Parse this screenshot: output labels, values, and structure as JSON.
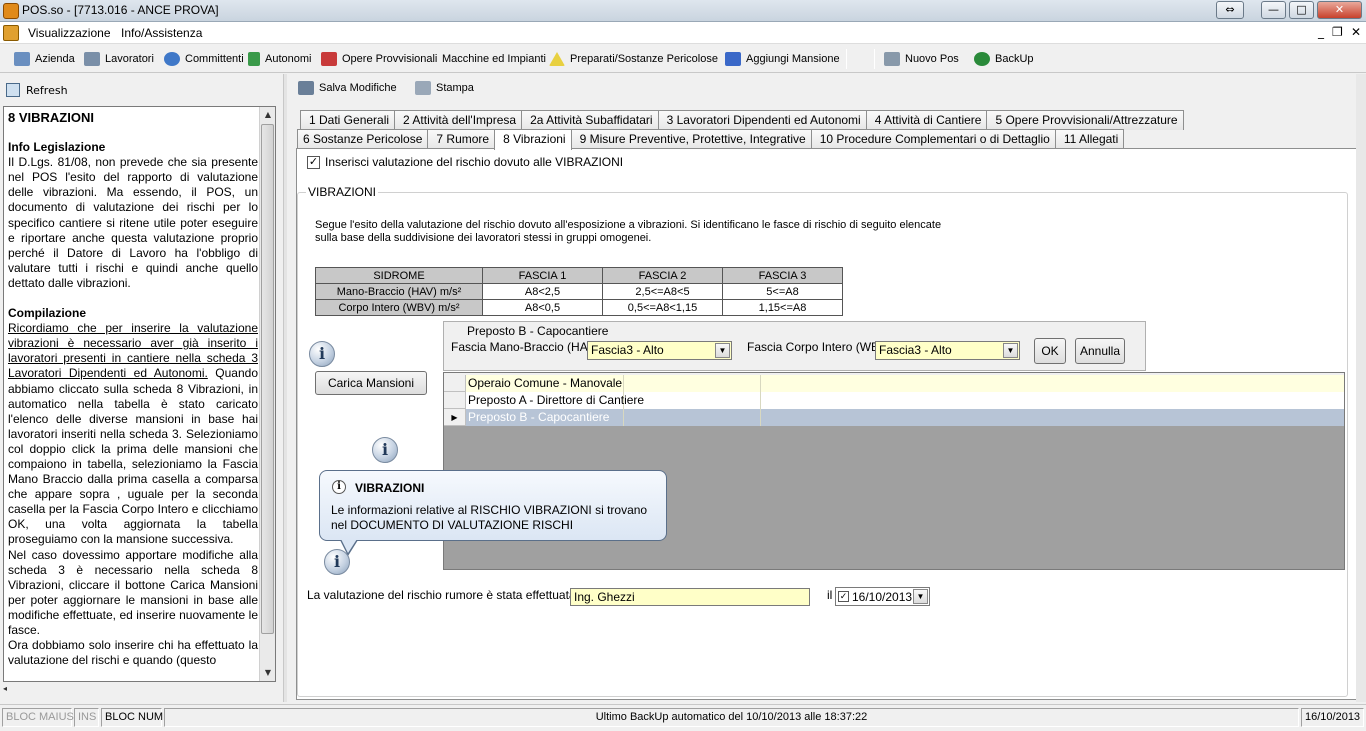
{
  "window": {
    "title": "POS.so - [7713.016 - ANCE PROVA]",
    "min": "—",
    "max": "□",
    "close": "✕",
    "restore": "⇔"
  },
  "menu": {
    "items": [
      "Visualizzazione",
      "Info/Assistenza"
    ],
    "mdi_min": "_",
    "mdi_restore": "❐",
    "mdi_close": "✕"
  },
  "toolbar": {
    "items": [
      {
        "label": "Azienda",
        "icon": "building-icon"
      },
      {
        "label": "Lavoratori",
        "icon": "worker-icon"
      },
      {
        "label": "Committenti",
        "icon": "people-icon"
      },
      {
        "label": "Autonomi",
        "icon": "person-icon"
      },
      {
        "label": "Opere Provvisionali",
        "icon": "truck-icon"
      },
      {
        "label": "Macchine ed Impianti",
        "icon": ""
      },
      {
        "label": "Preparati/Sostanze Pericolose",
        "icon": "hazard-icon"
      },
      {
        "label": "Aggiungi Mansione",
        "icon": "puzzle-icon"
      },
      {
        "label": "Nuovo Pos",
        "icon": "new-doc-icon"
      },
      {
        "label": "BackUp",
        "icon": "backup-icon"
      }
    ]
  },
  "left": {
    "refresh": "Refresh",
    "help": {
      "title": "8 VIBRAZIONI",
      "s1_title": "Info Legislazione",
      "s1_text": "Il D.Lgs. 81/08, non prevede che sia presente nel POS l'esito del rapporto di valutazione delle vibrazioni. Ma essendo, il POS, un documento di valutazione dei rischi per lo specifico cantiere si ritene utile poter eseguire e riportare anche questa valutazione proprio perché il Datore di Lavoro ha l'obbligo di valutare tutti i rischi e quindi anche quello dettato dalle vibrazioni.",
      "s2_title": "Compilazione",
      "s2_underlined": "Ricordiamo che per inserire la valutazione vibrazioni è necessario aver già inserito i lavoratori presenti in cantiere nella scheda 3 Lavoratori Dipendenti ed Autonomi.",
      "s2_text": " Quando abbiamo cliccato sulla scheda 8 Vibrazioni, in automatico nella tabella è stato caricato l'elenco delle diverse mansioni in base hai lavoratori inseriti nella scheda 3. Selezioniamo col doppio click la prima delle mansioni che compaiono in tabella, selezioniamo la Fascia Mano Braccio dalla prima casella a comparsa che appare sopra , uguale per la seconda casella per la Fascia Corpo Intero e clicchiamo OK, una volta aggiornata la tabella proseguiamo con la mansione successiva.",
      "s3_text": " Nel caso dovessimo apportare modifiche alla scheda 3 è necessario nella scheda 8 Vibrazioni, cliccare il bottone Carica Mansioni per poter aggiornare le mansioni in base alle modifiche effettuate, ed inserire nuovamente le fasce.",
      "s4_text": "Ora dobbiamo solo inserire chi ha effettuato la valutazione del rischi e quando (questo"
    }
  },
  "right": {
    "save": "Salva Modifiche",
    "print": "Stampa",
    "tabs_row1": [
      "1 Dati Generali",
      "2 Attività dell'Impresa",
      "2a Attività Subaffidatari",
      "3 Lavoratori Dipendenti ed Autonomi",
      "4 Attività di Cantiere",
      "5 Opere Provvisionali/Attrezzature"
    ],
    "tabs_row2": [
      "6 Sostanze Pericolose",
      "7 Rumore",
      "8 Vibrazioni",
      "9 Misure Preventive, Protettive, Integrative",
      "10 Procedure Complementari o di Dettaglio",
      "11 Allegati"
    ],
    "active_tab": "8 Vibrazioni",
    "checkbox_label": "Inserisci valutazione del rischio dovuto alle VIBRAZIONI",
    "checkbox_mark": "✓",
    "group_label": "VIBRAZIONI",
    "description": "Segue l'esito della valutazione del rischio dovuto all'esposizione a vibrazioni. Si identificano le fasce di rischio di seguito elencate sulla base della suddivisione dei lavoratori stessi in gruppi omogenei.",
    "fasce_table": {
      "header": [
        "SIDROME",
        "FASCIA 1",
        "FASCIA 2",
        "FASCIA 3"
      ],
      "rows": [
        [
          "Mano-Braccio (HAV) m/s²",
          "A8<2,5",
          "2,5<=A8<5",
          "5<=A8"
        ],
        [
          "Corpo Intero (WBV) m/s²",
          "A8<0,5",
          "0,5<=A8<1,15",
          "1,15<=A8"
        ]
      ]
    },
    "edit": {
      "selected_mansione": "Preposto B - Capocantiere",
      "hav_label": "Fascia Mano-Braccio (HAV)",
      "hav_value": "Fascia3 - Alto",
      "wbv_label": "Fascia Corpo Intero (WBV)",
      "wbv_value": "Fascia3 - Alto",
      "ok": "OK",
      "cancel": "Annulla"
    },
    "carica": "Carica Mansioni",
    "grid_rows": [
      {
        "name": "Operaio Comune - Manovale",
        "indicator": ""
      },
      {
        "name": "Preposto A - Direttore di Cantiere",
        "indicator": ""
      },
      {
        "name": "Preposto B - Capocantiere",
        "indicator": "▶"
      }
    ],
    "balloon": {
      "title": "VIBRAZIONI",
      "text": "Le informazioni relative al RISCHIO VIBRAZIONI si trovano nel DOCUMENTO DI VALUTAZIONE RISCHI"
    },
    "eval_label": "La valutazione del rischio rumore è stata effettuata da:",
    "eval_value": "Ing. Ghezzi",
    "il_label": "il",
    "date": "16/10/2013",
    "date_check": "✓"
  },
  "status": {
    "caps": "BLOC MAIUS",
    "ins": "INS",
    "num": "BLOC NUM",
    "message": "Ultimo BackUp automatico del 10/10/2013 alle 18:37:22",
    "date": "16/10/2013"
  },
  "symbols": {
    "info": "i",
    "dropdown": "▼",
    "up": "▲",
    "down": "▼",
    "left": "◂"
  }
}
